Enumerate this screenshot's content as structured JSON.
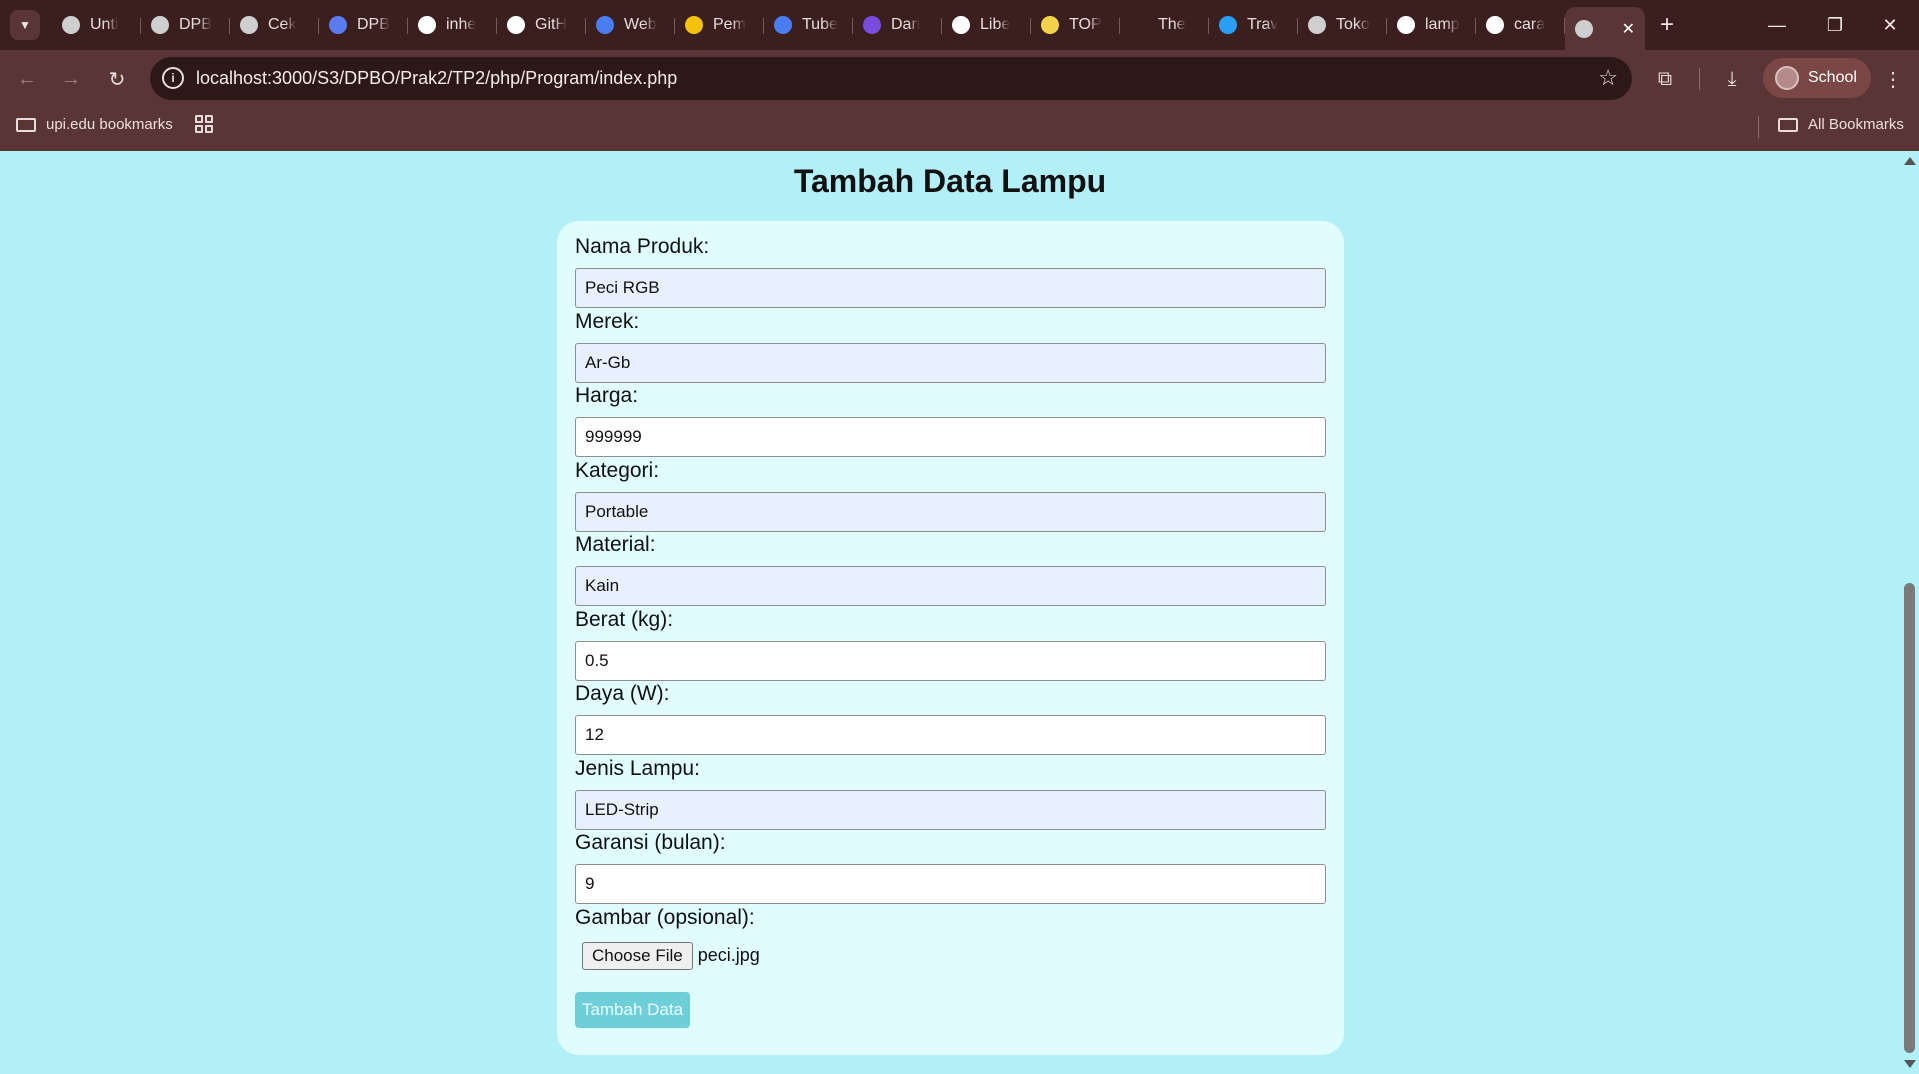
{
  "browser": {
    "tabs": [
      {
        "title": "Unti",
        "icon": "app-icon",
        "color": "#cfcfcf"
      },
      {
        "title": "DPB",
        "icon": "globe-icon",
        "color": "#cfcfcf"
      },
      {
        "title": "Cek",
        "icon": "chatgpt-icon",
        "color": "#cfcfcf"
      },
      {
        "title": "DPB",
        "icon": "colorful-logo-icon",
        "color": "#5b7bf0"
      },
      {
        "title": "inhe",
        "icon": "google-icon",
        "color": "#ffffff"
      },
      {
        "title": "GitH",
        "icon": "github-icon",
        "color": "#ffffff"
      },
      {
        "title": "Web",
        "icon": "contacts-icon",
        "color": "#4a7df0"
      },
      {
        "title": "Pem",
        "icon": "slides-icon",
        "color": "#f4c20d"
      },
      {
        "title": "Tube",
        "icon": "docs-icon",
        "color": "#4a7df0"
      },
      {
        "title": "Dari",
        "icon": "forms-icon",
        "color": "#7a4be0"
      },
      {
        "title": "Libe",
        "icon": "book-icon",
        "color": "#ffffff"
      },
      {
        "title": "TOP",
        "icon": "tp-logo-icon",
        "color": "#f3d34a"
      },
      {
        "title": "The",
        "icon": "blank-icon",
        "color": "transparent"
      },
      {
        "title": "Trav",
        "icon": "bird-icon",
        "color": "#2a9df4"
      },
      {
        "title": "Toko",
        "icon": "globe-icon",
        "color": "#cfcfcf"
      },
      {
        "title": "lamp",
        "icon": "google-icon",
        "color": "#ffffff"
      },
      {
        "title": "cara",
        "icon": "google-icon",
        "color": "#ffffff"
      }
    ],
    "active_tab_icon": "globe-icon",
    "close_glyph": "✕",
    "new_tab_glyph": "+",
    "url": "localhost:3000/S3/DPBO/Prak2/TP2/php/Program/index.php",
    "profile_label": "School",
    "bookmarks": {
      "folder_label": "upi.edu bookmarks",
      "all_label": "All Bookmarks"
    }
  },
  "page": {
    "title": "Tambah Data Lampu",
    "fields": [
      {
        "label": "Nama Produk:",
        "value": "Peci RGB",
        "autofill": true
      },
      {
        "label": "Merek:",
        "value": "Ar-Gb",
        "autofill": true
      },
      {
        "label": "Harga:",
        "value": "999999",
        "autofill": false
      },
      {
        "label": "Kategori:",
        "value": "Portable",
        "autofill": true
      },
      {
        "label": "Material:",
        "value": "Kain",
        "autofill": true
      },
      {
        "label": "Berat (kg):",
        "value": "0.5",
        "autofill": false
      },
      {
        "label": "Daya (W):",
        "value": "12",
        "autofill": false
      },
      {
        "label": "Jenis Lampu:",
        "value": "LED-Strip",
        "autofill": true
      },
      {
        "label": "Garansi (bulan):",
        "value": "9",
        "autofill": false
      }
    ],
    "image_label": "Gambar (opsional):",
    "file_button": "Choose File",
    "file_name": "peci.jpg",
    "submit_label": "Tambah Data"
  },
  "colors": {
    "page_background": "#b2eff6",
    "card_background": "#e0fcfd",
    "submit_button": "#6fcfd8",
    "chrome": "#3b1f1f"
  }
}
